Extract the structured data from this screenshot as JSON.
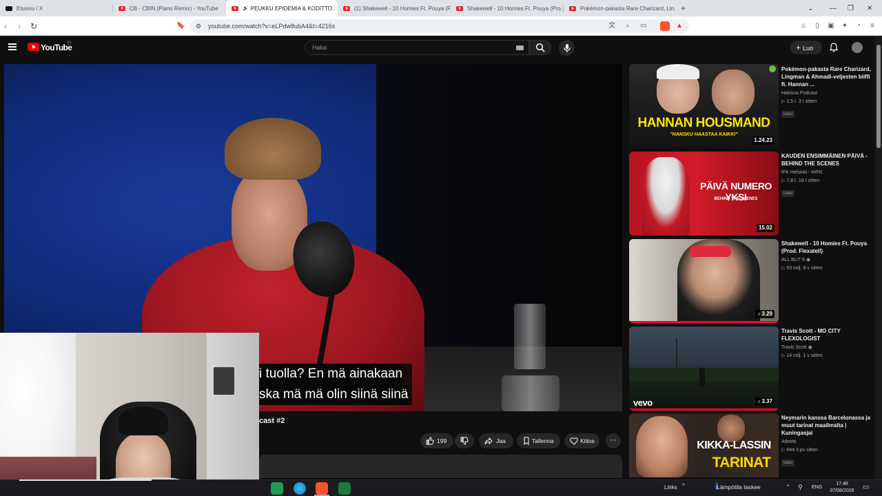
{
  "browser": {
    "tabs": [
      {
        "label": "Etusivu / X",
        "icon": "x-icon"
      },
      {
        "label": "CB - CBIN (Piano Remix) - YouTube",
        "icon": "youtube-icon"
      },
      {
        "label": "PEUKKU EPIDEMIA & KODITTO...",
        "icon": "youtube-icon",
        "active": true
      },
      {
        "label": "(1) Shakewell - 10 Homies Ft. Pouya (Pr...",
        "icon": "youtube-icon"
      },
      {
        "label": "Shakewell - 10 Homies Ft. Pouya (Pro...",
        "icon": "youtube-icon"
      },
      {
        "label": "Pokémon-pakasta Rare Charizard, Lin...",
        "icon": "youtube-icon"
      }
    ],
    "url": "youtube.com/watch?v=eLPdw8ubA4&t=4216s"
  },
  "youtube": {
    "logo_text": "YouTube",
    "country": "FI",
    "search_placeholder": "Haka",
    "create_label": "Luo"
  },
  "player": {
    "caption_line1": "i tuolla? En mä ainakaan",
    "caption_line2": "ska mä mä olin siinä siinä"
  },
  "video": {
    "title_fragment": "cast #2",
    "likes": "199",
    "share_label": "Jaa",
    "save_label": "Tallenna",
    "thanks_label": "Kiitos"
  },
  "recommendations": [
    {
      "title": "Pokémon-pakasta Rare Charizard, Lingman & Ahmadi-veljesten biiffi ft. Hannan ...",
      "channel": "Hakissa Podcast",
      "stats": "1,5 t.  3 t sitten",
      "badge": "Uusi",
      "duration": "1.24.23",
      "thumb_text": "HANNAN HOUSMAND",
      "thumb_sub": "\"HANSKU HAASTAA KAIKKI\""
    },
    {
      "title": "KAUDEN ENSIMMÄINEN PÄIVÄ - BEHIND THE SCENES",
      "channel": "IFK Helsinki - HIFK",
      "stats": "7,8 t.  18 t sitten",
      "badge": "Uusi",
      "duration": "15.02",
      "thumb_text": "PÄIVÄ NUMERO YKSI",
      "thumb_sub": "BEHIND THE SCENES"
    },
    {
      "title": "Shakewell - 10 Homies Ft. Pouya (Prod. Flexatell)",
      "channel": "ALL BUT 6",
      "stats": "53 milj.  8 v sitten",
      "badge": "",
      "duration": "3.29"
    },
    {
      "title": "Travis Scott - MO CITY FLEXOLOGIST",
      "channel": "Travis Scott",
      "stats": "14 milj.  1 v sitten",
      "badge": "",
      "duration": "3.37",
      "thumb_text": "vevo"
    },
    {
      "title": "Neymarin kanssa Barcelonassa ja muut tarinat maailmalta | Kuningasjai",
      "channel": "Atleetti",
      "stats": "844  3 pv sitten",
      "badge": "Uusi",
      "thumb_text": "KIKKA-LASSIN",
      "thumb_text2": "TARINAT"
    }
  ],
  "taskbar": {
    "links_label": "Links",
    "weather": "Lämpötila laskee",
    "lang": "ENG",
    "time": "17.48",
    "date": "07/08/2026"
  },
  "colors": {
    "yt_red": "#ff0000",
    "bg": "#0f0f0f",
    "chip": "#272727"
  }
}
